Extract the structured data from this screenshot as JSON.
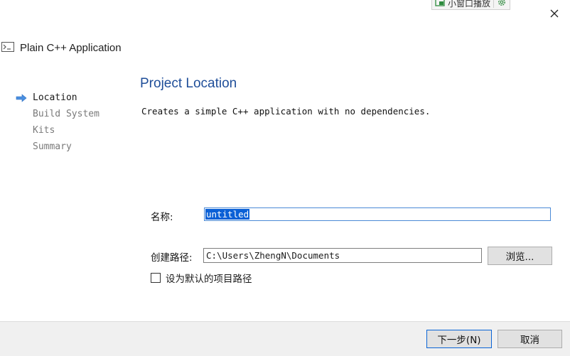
{
  "mini_player": {
    "label": "小窗口播放",
    "icons": [
      "mini-window-icon",
      "gear-icon"
    ]
  },
  "window": {
    "close_icon": "close-icon"
  },
  "header": {
    "title": "Plain C++ Application",
    "icon": "terminal-icon"
  },
  "steps": [
    {
      "label": "Location",
      "active": true
    },
    {
      "label": "Build System",
      "active": false
    },
    {
      "label": "Kits",
      "active": false
    },
    {
      "label": "Summary",
      "active": false
    }
  ],
  "page": {
    "title": "Project Location",
    "description": "Creates a simple C++ application with no dependencies."
  },
  "form": {
    "name_label": "名称:",
    "name_value": "untitled",
    "path_label": "创建路径:",
    "path_value": "C:\\Users\\ZhengN\\Documents",
    "browse_label": "浏览...",
    "default_checkbox_label": "设为默认的项目路径",
    "default_checked": false
  },
  "footer": {
    "next_label": "下一步(N)",
    "cancel_label": "取消"
  },
  "colors": {
    "accent": "#1f4e99",
    "selection": "#0a60d6",
    "focus": "#4a89d6"
  }
}
